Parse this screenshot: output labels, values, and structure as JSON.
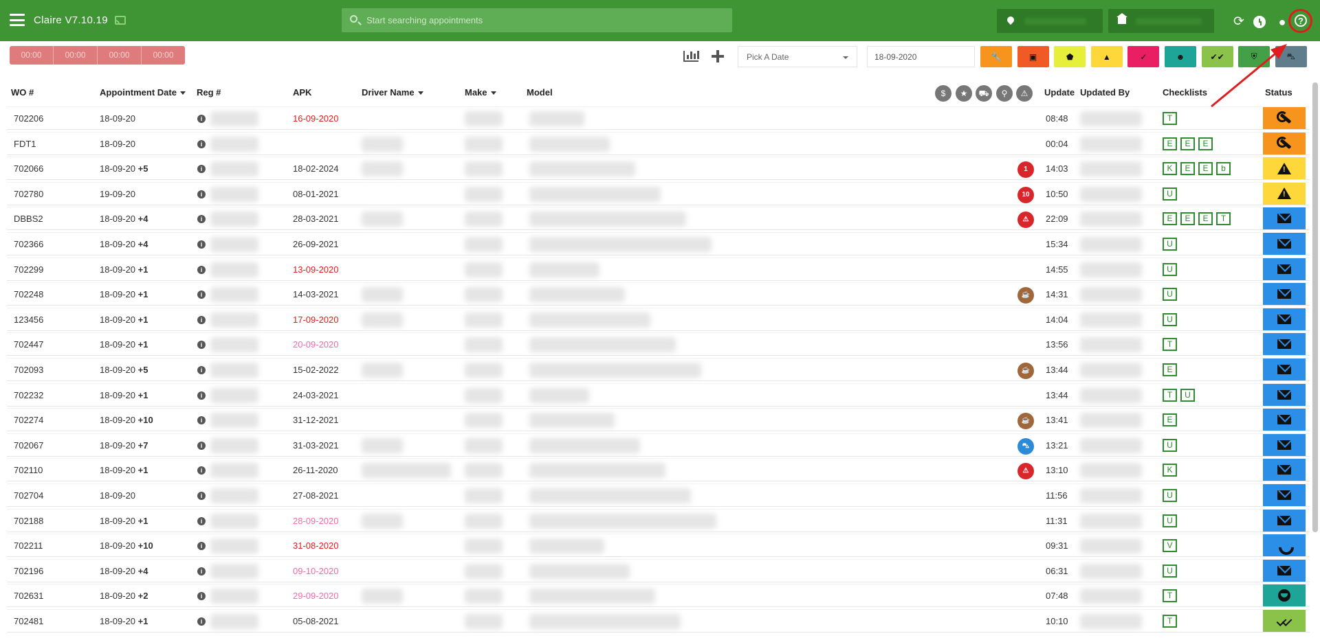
{
  "header": {
    "app_title": "Claire V7.10.19",
    "search_placeholder": "Start searching appointments"
  },
  "toolbar": {
    "timers": [
      "00:00",
      "00:00",
      "00:00",
      "00:00"
    ],
    "date_picker_label": "Pick A Date",
    "date_value": "18-09-2020",
    "filters": [
      {
        "name": "wrench",
        "color": "#f7941d"
      },
      {
        "name": "document",
        "color": "#f15a24"
      },
      {
        "name": "tag",
        "color": "#e6ef3a"
      },
      {
        "name": "warning",
        "color": "#fed83a"
      },
      {
        "name": "user-check",
        "color": "#e91e63"
      },
      {
        "name": "smiley",
        "color": "#1ea598"
      },
      {
        "name": "double-check",
        "color": "#8bc34a"
      },
      {
        "name": "shield",
        "color": "#43a047"
      },
      {
        "name": "car",
        "color": "#607d8b"
      }
    ]
  },
  "table": {
    "columns": {
      "wo": "WO #",
      "appointment_date": "Appointment Date",
      "reg": "Reg #",
      "apk": "APK",
      "driver_name": "Driver Name",
      "make": "Make",
      "model": "Model",
      "update": "Update",
      "updated_by": "Updated By",
      "checklists": "Checklists",
      "status": "Status"
    },
    "header_icons": [
      "dollar-icon",
      "star-icon",
      "cart-icon",
      "pin-icon",
      "warning-icon"
    ],
    "rows": [
      {
        "wo": "702206",
        "date": "18-09-20",
        "plus": "",
        "apk": "16-09-2020",
        "apk_style": "red",
        "badge": null,
        "update": "08:48",
        "checklists": [
          "T"
        ],
        "status": "wrench"
      },
      {
        "wo": "FDT1",
        "date": "18-09-20",
        "plus": "",
        "apk": "",
        "apk_style": "",
        "badge": null,
        "update": "00:04",
        "checklists": [
          "E",
          "E",
          "E"
        ],
        "status": "wrench"
      },
      {
        "wo": "702066",
        "date": "18-09-20",
        "plus": "+5",
        "apk": "18-02-2024",
        "apk_style": "",
        "badge": {
          "type": "red",
          "text": "1"
        },
        "update": "14:03",
        "checklists": [
          "K",
          "E",
          "E",
          "b"
        ],
        "status": "warning"
      },
      {
        "wo": "702780",
        "date": "19-09-20",
        "plus": "",
        "apk": "08-01-2021",
        "apk_style": "",
        "badge": {
          "type": "red",
          "text": "10"
        },
        "update": "10:50",
        "checklists": [
          "U"
        ],
        "status": "warning"
      },
      {
        "wo": "DBBS2",
        "date": "18-09-20",
        "plus": "+4",
        "apk": "28-03-2021",
        "apk_style": "",
        "badge": {
          "type": "red",
          "text": "⚠"
        },
        "update": "22:09",
        "checklists": [
          "E",
          "E",
          "E",
          "T"
        ],
        "status": "mail"
      },
      {
        "wo": "702366",
        "date": "18-09-20",
        "plus": "+4",
        "apk": "26-09-2021",
        "apk_style": "",
        "badge": null,
        "update": "15:34",
        "checklists": [
          "U"
        ],
        "status": "mail"
      },
      {
        "wo": "702299",
        "date": "18-09-20",
        "plus": "+1",
        "apk": "13-09-2020",
        "apk_style": "red",
        "badge": null,
        "update": "14:55",
        "checklists": [
          "U"
        ],
        "status": "mail"
      },
      {
        "wo": "702248",
        "date": "18-09-20",
        "plus": "+1",
        "apk": "14-03-2021",
        "apk_style": "",
        "badge": {
          "type": "brown",
          "text": "☕"
        },
        "update": "14:31",
        "checklists": [
          "U"
        ],
        "status": "mail"
      },
      {
        "wo": "123456",
        "date": "18-09-20",
        "plus": "+1",
        "apk": "17-09-2020",
        "apk_style": "red",
        "badge": null,
        "update": "14:04",
        "checklists": [
          "U"
        ],
        "status": "mail"
      },
      {
        "wo": "702447",
        "date": "18-09-20",
        "plus": "+1",
        "apk": "20-09-2020",
        "apk_style": "pink",
        "badge": null,
        "update": "13:56",
        "checklists": [
          "T"
        ],
        "status": "mail"
      },
      {
        "wo": "702093",
        "date": "18-09-20",
        "plus": "+5",
        "apk": "15-02-2022",
        "apk_style": "",
        "badge": {
          "type": "brown",
          "text": "☕"
        },
        "update": "13:44",
        "checklists": [
          "E"
        ],
        "status": "mail"
      },
      {
        "wo": "702232",
        "date": "18-09-20",
        "plus": "+1",
        "apk": "24-03-2021",
        "apk_style": "",
        "badge": null,
        "update": "13:44",
        "checklists": [
          "T",
          "U"
        ],
        "status": "mail"
      },
      {
        "wo": "702274",
        "date": "18-09-20",
        "plus": "+10",
        "apk": "31-12-2021",
        "apk_style": "",
        "badge": {
          "type": "brown",
          "text": "☕"
        },
        "update": "13:41",
        "checklists": [
          "E"
        ],
        "status": "mail"
      },
      {
        "wo": "702067",
        "date": "18-09-20",
        "plus": "+7",
        "apk": "31-03-2021",
        "apk_style": "",
        "badge": {
          "type": "blue",
          "text": "⛍"
        },
        "update": "13:21",
        "checklists": [
          "U"
        ],
        "status": "mail"
      },
      {
        "wo": "702110",
        "date": "18-09-20",
        "plus": "+1",
        "apk": "26-11-2020",
        "apk_style": "",
        "badge": {
          "type": "red",
          "text": "⚠"
        },
        "update": "13:10",
        "checklists": [
          "K"
        ],
        "status": "mail"
      },
      {
        "wo": "702704",
        "date": "18-09-20",
        "plus": "",
        "apk": "27-08-2021",
        "apk_style": "",
        "badge": null,
        "update": "11:56",
        "checklists": [
          "U"
        ],
        "status": "mail"
      },
      {
        "wo": "702188",
        "date": "18-09-20",
        "plus": "+1",
        "apk": "28-09-2020",
        "apk_style": "pink",
        "badge": null,
        "update": "11:31",
        "checklists": [
          "U"
        ],
        "status": "mail"
      },
      {
        "wo": "702211",
        "date": "18-09-20",
        "plus": "+10",
        "apk": "31-08-2020",
        "apk_style": "red",
        "badge": null,
        "update": "09:31",
        "checklists": [
          "V"
        ],
        "status": "phone"
      },
      {
        "wo": "702196",
        "date": "18-09-20",
        "plus": "+4",
        "apk": "09-10-2020",
        "apk_style": "pink",
        "badge": null,
        "update": "06:31",
        "checklists": [
          "U"
        ],
        "status": "mail"
      },
      {
        "wo": "702631",
        "date": "18-09-20",
        "plus": "+2",
        "apk": "29-09-2020",
        "apk_style": "pink",
        "badge": null,
        "update": "07:48",
        "checklists": [
          "T"
        ],
        "status": "smiley"
      },
      {
        "wo": "702481",
        "date": "18-09-20",
        "plus": "+1",
        "apk": "05-08-2021",
        "apk_style": "",
        "badge": null,
        "update": "10:10",
        "checklists": [
          "T"
        ],
        "status": "double-check"
      }
    ]
  },
  "status_colors": {
    "wrench": "#f7941d",
    "warning": "#fed83a",
    "mail": "#2b8fe8",
    "phone": "#2b8fe8",
    "smiley": "#1ea598",
    "double-check": "#8bc34a"
  },
  "badge_colors": {
    "red": "#d9262b",
    "brown": "#a0673a",
    "blue": "#2c8ad6"
  }
}
